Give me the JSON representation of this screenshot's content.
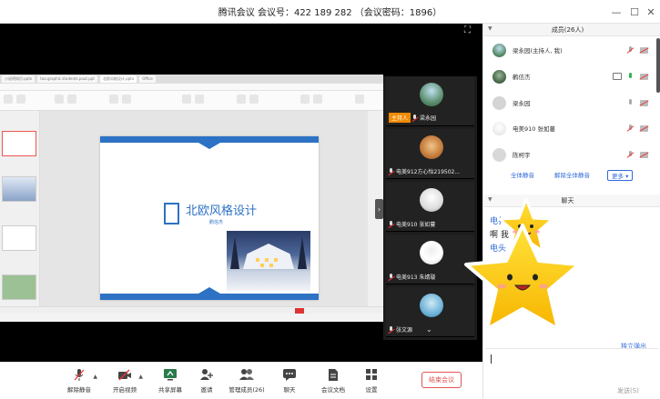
{
  "window": {
    "title": "腾讯会议 会议号：422 189 282 （会议密码：1896）"
  },
  "share": {
    "tabs": [
      "小说明知识.pptx",
      "tao.graphic.students.pout.ppt",
      "北欧风格设计.pptx",
      "Office"
    ],
    "slide_title": "北欧风格设计",
    "slide_author": "鹳信杰"
  },
  "videos": [
    {
      "host_badge": "主持人",
      "name": "梁永园"
    },
    {
      "name": "电美912方心怡219502..."
    },
    {
      "name": "电美910 张如蔓"
    },
    {
      "name": "电美913 朱婧璇"
    },
    {
      "name": "张文源"
    }
  ],
  "toolbar": {
    "mute": "解除静音",
    "video": "开启视频",
    "share": "共享屏幕",
    "invite": "邀请",
    "members": "管理成员(26)",
    "chat": "聊天",
    "docs": "会议文档",
    "settings": "设置",
    "end": "结束会议"
  },
  "members_panel": {
    "title": "成员(26人)",
    "members": [
      {
        "name": "梁永园(主持人, 我)"
      },
      {
        "name": "鹳信杰"
      },
      {
        "name": "梁永园"
      },
      {
        "name": "电美910 张如蔓"
      },
      {
        "name": "陈柯宇"
      }
    ],
    "mute_all": "全体静音",
    "unmute_all": "解除全体静音",
    "more": "更多 ▾"
  },
  "chat_panel": {
    "title": "聊天",
    "lines": [
      "电扌",
      "啊 我",
      "电头"
    ],
    "detach": "独立弹出",
    "send": "发送(S)"
  },
  "colors": {
    "accent": "#2f6ad9",
    "host": "#f08a00",
    "danger": "#e25454",
    "slide_blue": "#2d72c4"
  }
}
